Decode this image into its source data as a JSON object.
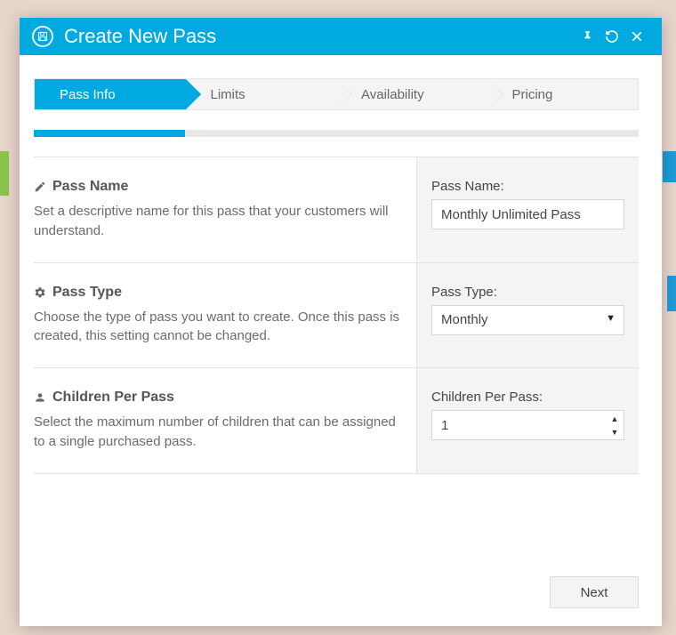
{
  "header": {
    "title": "Create New Pass"
  },
  "steps": {
    "items": [
      {
        "label": "Pass Info"
      },
      {
        "label": "Limits"
      },
      {
        "label": "Availability"
      },
      {
        "label": "Pricing"
      }
    ]
  },
  "sections": {
    "passName": {
      "heading": "Pass Name",
      "desc": "Set a descriptive name for this pass that your customers will understand.",
      "label": "Pass Name:",
      "value": "Monthly Unlimited Pass"
    },
    "passType": {
      "heading": "Pass Type",
      "desc": "Choose the type of pass you want to create. Once this pass is created, this setting cannot be changed.",
      "label": "Pass Type:",
      "value": "Monthly"
    },
    "childrenPerPass": {
      "heading": "Children Per Pass",
      "desc": "Select the maximum number of children that can be assigned to a single purchased pass.",
      "label": "Children Per Pass:",
      "value": "1"
    }
  },
  "footer": {
    "nextLabel": "Next"
  }
}
